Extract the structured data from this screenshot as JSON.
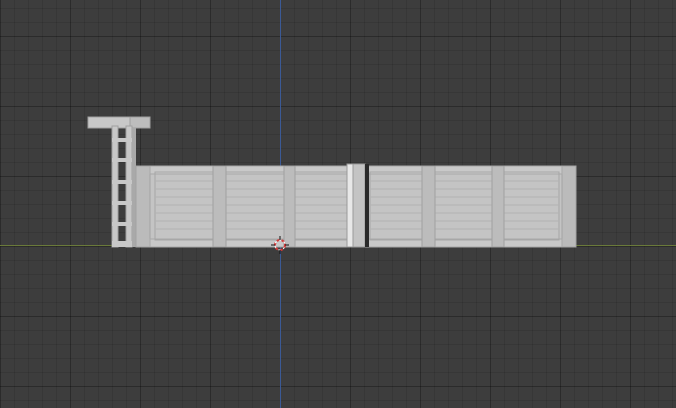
{
  "viewport": {
    "view": "orthographic-front",
    "grid": true,
    "axes": [
      "x-axis-red-green",
      "z-axis-blue"
    ],
    "colors": {
      "background": "#3d3d3d",
      "mesh": "#c4c4c4",
      "mesh_edge": "#9a9a9a",
      "z_axis": "#3b5a96",
      "x_axis": "#6a7a3a"
    }
  },
  "objects": [
    {
      "name": "ladder",
      "icon": "mesh-object"
    },
    {
      "name": "wall",
      "icon": "mesh-object"
    },
    {
      "name": "wall-panels",
      "count": 6
    },
    {
      "name": "divider-post"
    }
  ],
  "cursor": {
    "icon": "3d-cursor-icon"
  }
}
